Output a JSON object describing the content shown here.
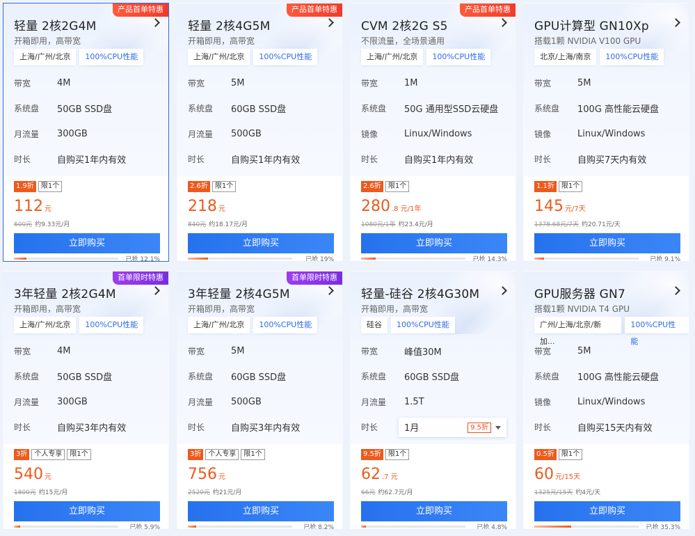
{
  "buy_label": "立即购买",
  "colors": {
    "accent": "#2e6be6",
    "price": "#ec5a1c",
    "tag_red": "#f03a2a",
    "tag_purple": "#8a35e8"
  },
  "cards": [
    {
      "tag": "产品首单特惠",
      "tag_color": "red",
      "title": "轻量 2核2G4M",
      "subtitle": "开箱即用，高带宽",
      "chips": [
        "上海/广州/北京",
        "100%CPU性能"
      ],
      "specs": [
        {
          "k": "带宽",
          "v": "4M"
        },
        {
          "k": "系统盘",
          "v": "50GB SSD盘"
        },
        {
          "k": "月流量",
          "v": "300GB"
        },
        {
          "k": "时长",
          "v": "自购买1年内有效"
        }
      ],
      "discount": "1.9折",
      "extra_badge": "",
      "limit": "限1个",
      "price_big": "112",
      "price_small": "元",
      "orig_price": "600元",
      "avg_price": "约9.33元/月",
      "sold_text": "已抢 12.1%",
      "sold_pct": 12.1
    },
    {
      "tag": "产品首单特惠",
      "tag_color": "red",
      "title": "轻量 2核4G5M",
      "subtitle": "开箱即用，高带宽",
      "chips": [
        "上海/广州/北京",
        "100%CPU性能"
      ],
      "specs": [
        {
          "k": "带宽",
          "v": "5M"
        },
        {
          "k": "系统盘",
          "v": "60GB SSD盘"
        },
        {
          "k": "月流量",
          "v": "500GB"
        },
        {
          "k": "时长",
          "v": "自购买1年内有效"
        }
      ],
      "discount": "2.6折",
      "extra_badge": "",
      "limit": "限1个",
      "price_big": "218",
      "price_small": "元",
      "orig_price": "840元",
      "avg_price": "约18.17元/月",
      "sold_text": "已抢 19%",
      "sold_pct": 19
    },
    {
      "tag": "产品首单特惠",
      "tag_color": "red",
      "title": "CVM 2核2G S5",
      "subtitle": "不限流量，全场景通用",
      "chips": [
        "上海/广州/北京",
        "100%CPU性能"
      ],
      "specs": [
        {
          "k": "带宽",
          "v": "1M"
        },
        {
          "k": "系统盘",
          "v": "50G 通用型SSD云硬盘"
        },
        {
          "k": "镜像",
          "v": "Linux/Windows"
        },
        {
          "k": "时长",
          "v": "自购买1年内有效"
        }
      ],
      "discount": "2.6折",
      "extra_badge": "",
      "limit": "限1个",
      "price_big": "280",
      "price_small": ".8 元/1年",
      "orig_price": "1080元/1年",
      "avg_price": "约23.4元/月",
      "sold_text": "已抢 14.3%",
      "sold_pct": 14.3
    },
    {
      "tag": "",
      "tag_color": "",
      "title": "GPU计算型 GN10Xp",
      "subtitle": "搭载1颗 NVIDIA V100 GPU",
      "chips": [
        "北京/上海/南京",
        "100%CPU性能"
      ],
      "specs": [
        {
          "k": "带宽",
          "v": "5M"
        },
        {
          "k": "系统盘",
          "v": "100G 高性能云硬盘"
        },
        {
          "k": "镜像",
          "v": "Linux/Windows"
        },
        {
          "k": "时长",
          "v": "自购买7天内有效"
        }
      ],
      "discount": "1.1折",
      "extra_badge": "",
      "limit": "限1个",
      "price_big": "145",
      "price_small": "元/7天",
      "orig_price": "1378.68元/7天",
      "avg_price": "约20.71元/天",
      "sold_text": "已抢 9.1%",
      "sold_pct": 9.1
    },
    {
      "tag": "首单限时特惠",
      "tag_color": "purple",
      "title": "3年轻量 2核2G4M",
      "subtitle": "开箱即用，高带宽",
      "chips": [
        "上海/广州/北京",
        "100%CPU性能"
      ],
      "specs": [
        {
          "k": "带宽",
          "v": "4M"
        },
        {
          "k": "系统盘",
          "v": "50GB SSD盘"
        },
        {
          "k": "月流量",
          "v": "300GB"
        },
        {
          "k": "时长",
          "v": "自购买3年内有效"
        }
      ],
      "discount": "3折",
      "extra_badge": "个人专享",
      "limit": "限1个",
      "price_big": "540",
      "price_small": "元",
      "orig_price": "1800元",
      "avg_price": "约15元/月",
      "sold_text": "已抢 5.9%",
      "sold_pct": 5.9
    },
    {
      "tag": "首单限时特惠",
      "tag_color": "purple",
      "title": "3年轻量 2核4G5M",
      "subtitle": "开箱即用，高带宽",
      "chips": [
        "上海/广州/北京",
        "100%CPU性能"
      ],
      "specs": [
        {
          "k": "带宽",
          "v": "5M"
        },
        {
          "k": "系统盘",
          "v": "60GB SSD盘"
        },
        {
          "k": "月流量",
          "v": "500GB"
        },
        {
          "k": "时长",
          "v": "自购买3年内有效"
        }
      ],
      "discount": "3折",
      "extra_badge": "个人专享",
      "limit": "限1个",
      "price_big": "756",
      "price_small": "元",
      "orig_price": "2520元",
      "avg_price": "约21元/月",
      "sold_text": "已抢 8.2%",
      "sold_pct": 8.2
    },
    {
      "tag": "",
      "tag_color": "",
      "title": "轻量-硅谷 2核4G30M",
      "subtitle": "开箱即用，高带宽",
      "chips": [
        "硅谷",
        "100%CPU性能"
      ],
      "specs": [
        {
          "k": "带宽",
          "v": "峰值30M"
        },
        {
          "k": "系统盘",
          "v": "60GB SSD盘"
        },
        {
          "k": "月流量",
          "v": "1.5T"
        }
      ],
      "duration_dropdown": {
        "k": "时长",
        "value": "1月",
        "badge": "9.5折"
      },
      "discount": "9.5折",
      "extra_badge": "",
      "limit": "限1个",
      "price_big": "62",
      "price_small": ".7 元",
      "orig_price": "66元",
      "avg_price": "约62.7元/月",
      "sold_text": "已抢 4.8%",
      "sold_pct": 4.8
    },
    {
      "tag": "",
      "tag_color": "",
      "title": "GPU服务器 GN7",
      "subtitle": "搭载1颗 NVIDIA T4 GPU",
      "chips": [
        "广州/上海/北京/新加...",
        "100%CPU性能"
      ],
      "specs": [
        {
          "k": "带宽",
          "v": "5M"
        },
        {
          "k": "系统盘",
          "v": "100G 高性能云硬盘"
        },
        {
          "k": "镜像",
          "v": "Linux/Windows"
        },
        {
          "k": "时长",
          "v": "自购买15天内有效"
        }
      ],
      "discount": "0.5折",
      "extra_badge": "",
      "limit": "限1个",
      "price_big": "60",
      "price_small": "元/15天",
      "orig_price": "1325元/15天",
      "avg_price": "约4元/天",
      "sold_text": "已抢 35.3%",
      "sold_pct": 35.3
    }
  ]
}
